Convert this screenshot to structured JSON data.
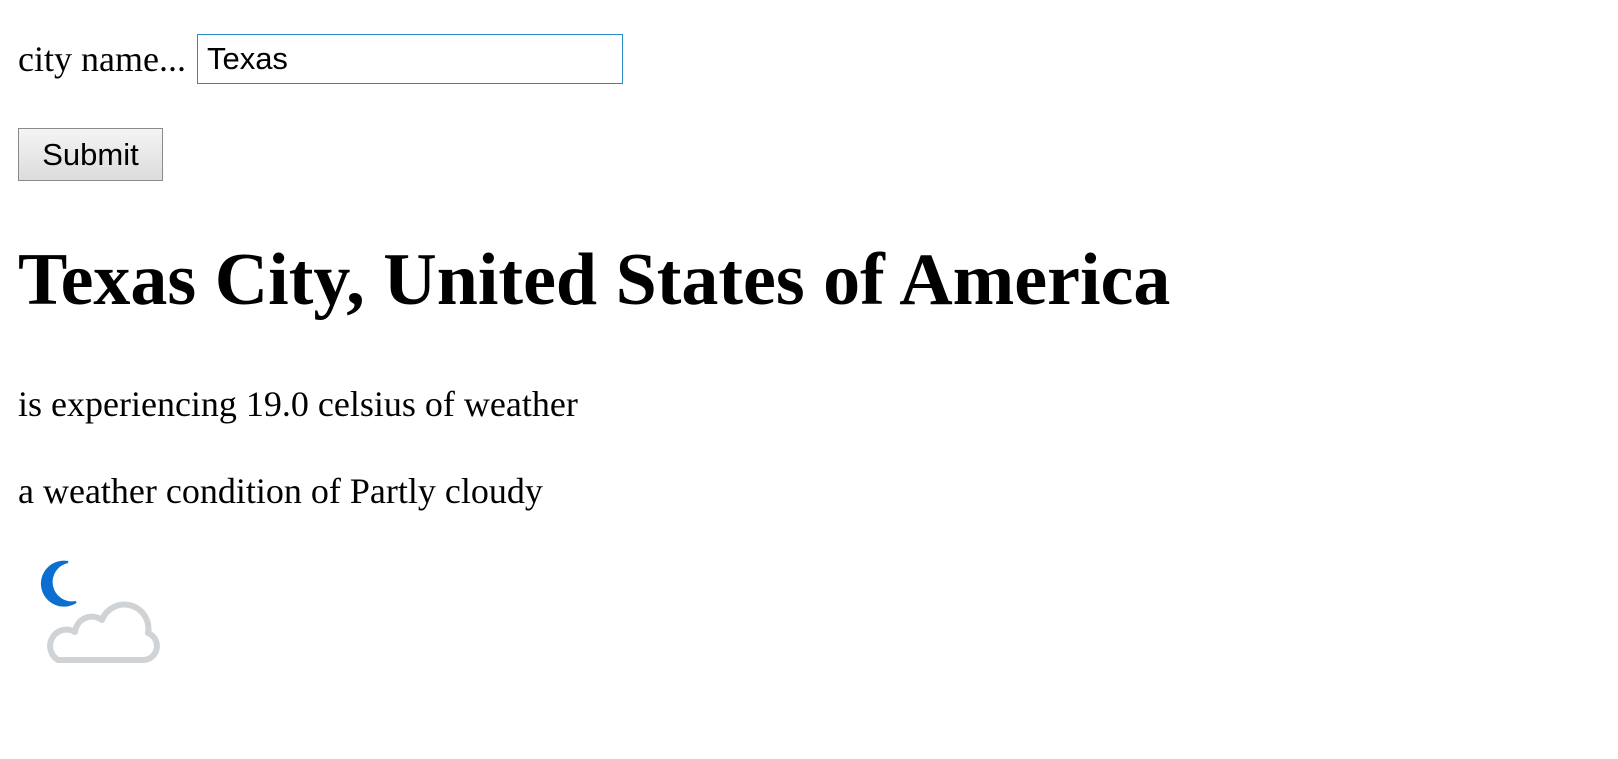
{
  "search": {
    "label": "city name...",
    "value": "Texas",
    "submit_label": "Submit"
  },
  "result": {
    "location": "Texas City, United States of America",
    "temperature_text": "is experiencing 19.0 celsius of weather",
    "condition_text": "a weather condition of Partly cloudy",
    "icon": "partly-cloudy-night-icon"
  },
  "colors": {
    "moon": "#0a6fd0",
    "cloud": "#cfd3d6",
    "input_border": "#2a8ac4"
  }
}
